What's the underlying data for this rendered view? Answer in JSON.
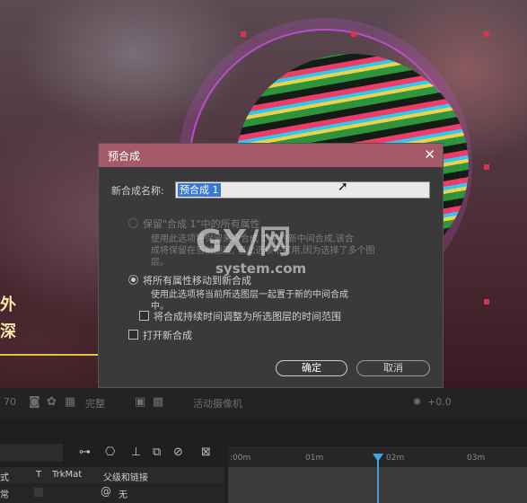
{
  "dialog": {
    "title": "预合成",
    "close_glyph": "✕",
    "name_label": "新合成名称:",
    "name_value": "预合成 1",
    "option_keep_label": "保留\"合成 1\"中的所有属性",
    "option_keep_desc_1": "使用此选项将保留来自合成 1 中的新中间合成,该合",
    "option_keep_desc_2": "成将保留在当前图层,  但此选项不可用,因为选择了多个图",
    "option_keep_desc_3": "层。",
    "option_move_label": "将所有属性移动到新合成",
    "option_move_desc": "使用此选项将当前所选图层一起置于新的中间合成",
    "option_move_desc_2": "中。",
    "checkbox_adjust_label": "将合成持续时间调整为所选图层的时间范围",
    "checkbox_open_label": "打开新合成",
    "ok_label": "确定",
    "cancel_label": "取消"
  },
  "background": {
    "side_text_1": "外",
    "side_text_2": "深"
  },
  "toolbar": {
    "zoom_text": "完整",
    "camera_text": "活动摄像机",
    "value_text": "+0.0"
  },
  "timeline": {
    "ticks": [
      ":00m",
      "01m",
      "02m",
      "03m"
    ],
    "col_style": "式",
    "col_t": "T",
    "col_trkmat": "TrkMat",
    "col_parent": "父级和链接",
    "row_mode": "常",
    "row_parent_value": "无"
  },
  "watermark": {
    "brand": "GX/网",
    "domain": "system.com"
  },
  "colors": {
    "dialog_title_bar": "#a55a6a",
    "selection": "#3a78d6",
    "playhead": "#3ea3e6"
  }
}
